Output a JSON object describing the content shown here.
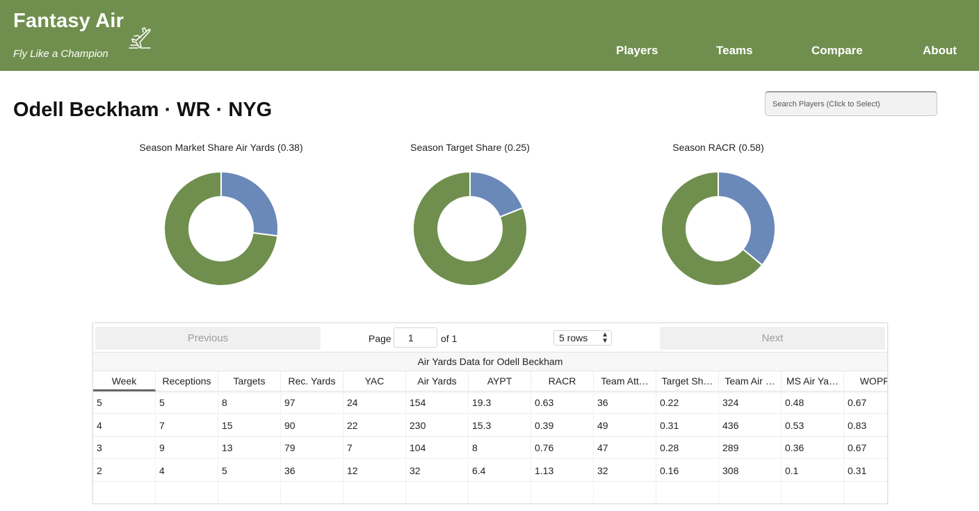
{
  "header": {
    "title": "Fantasy Air",
    "tagline": "Fly Like a Champion",
    "logo_icon": "airplane-icon",
    "background": "#708f4e",
    "nav": [
      {
        "label": "Players"
      },
      {
        "label": "Teams"
      },
      {
        "label": "Compare"
      },
      {
        "label": "About"
      }
    ]
  },
  "player": {
    "title": "Odell Beckham · WR · NYG"
  },
  "search": {
    "placeholder": "Search Players (Click to Select)"
  },
  "charts": {
    "colors": {
      "share": "#6a88b8",
      "remainder": "#708f4e"
    },
    "items": [
      {
        "title": "Season Market Share Air Yards (0.38)",
        "value": 0.27
      },
      {
        "title": "Season Target Share (0.25)",
        "value": 0.19
      },
      {
        "title": "Season RACR (0.58)",
        "value": 0.36
      }
    ]
  },
  "table": {
    "previous_label": "Previous",
    "next_label": "Next",
    "page_label": "Page",
    "page_value": "1",
    "of_label": "of 1",
    "rows_label": "5 rows",
    "caption": "Air Yards Data for Odell Beckham",
    "columns": [
      "Week",
      "Receptions",
      "Targets",
      "Rec. Yards",
      "YAC",
      "Air Yards",
      "AYPT",
      "RACR",
      "Team Att…",
      "Target Sh…",
      "Team Air …",
      "MS Air Ya…",
      "WOPR"
    ],
    "rows": [
      [
        "5",
        "5",
        "8",
        "97",
        "24",
        "154",
        "19.3",
        "0.63",
        "36",
        "0.22",
        "324",
        "0.48",
        "0.67"
      ],
      [
        "4",
        "7",
        "15",
        "90",
        "22",
        "230",
        "15.3",
        "0.39",
        "49",
        "0.31",
        "436",
        "0.53",
        "0.83"
      ],
      [
        "3",
        "9",
        "13",
        "79",
        "7",
        "104",
        "8",
        "0.76",
        "47",
        "0.28",
        "289",
        "0.36",
        "0.67"
      ],
      [
        "2",
        "4",
        "5",
        "36",
        "12",
        "32",
        "6.4",
        "1.13",
        "32",
        "0.16",
        "308",
        "0.1",
        "0.31"
      ],
      [
        "",
        "",
        "",
        "",
        "",
        "",
        "",
        "",
        "",
        "",
        "",
        "",
        ""
      ]
    ]
  }
}
